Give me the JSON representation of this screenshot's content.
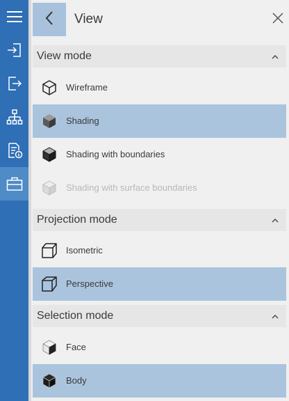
{
  "rail": {
    "items": [
      {
        "name": "menu-icon"
      },
      {
        "name": "import-icon"
      },
      {
        "name": "export-icon"
      },
      {
        "name": "hierarchy-icon"
      },
      {
        "name": "document-info-icon"
      },
      {
        "name": "toolbox-icon",
        "active": true
      }
    ],
    "accent": "#2e6fb5"
  },
  "panel": {
    "title": "View",
    "sections": [
      {
        "label": "View mode",
        "items": [
          {
            "label": "Wireframe",
            "icon": "wireframe-cube-icon"
          },
          {
            "label": "Shading",
            "icon": "shaded-cube-icon",
            "selected": true
          },
          {
            "label": "Shading with boundaries",
            "icon": "shaded-boundaries-cube-icon"
          },
          {
            "label": "Shading with surface boundaries",
            "icon": "surface-boundaries-cube-icon",
            "disabled": true
          }
        ]
      },
      {
        "label": "Projection mode",
        "items": [
          {
            "label": "Isometric",
            "icon": "isometric-cube-icon"
          },
          {
            "label": "Perspective",
            "icon": "perspective-cube-icon",
            "selected": true
          }
        ]
      },
      {
        "label": "Selection mode",
        "items": [
          {
            "label": "Face",
            "icon": "face-select-icon"
          },
          {
            "label": "Body",
            "icon": "body-select-icon",
            "selected": true
          }
        ]
      }
    ],
    "selected_color": "#aac4de"
  }
}
